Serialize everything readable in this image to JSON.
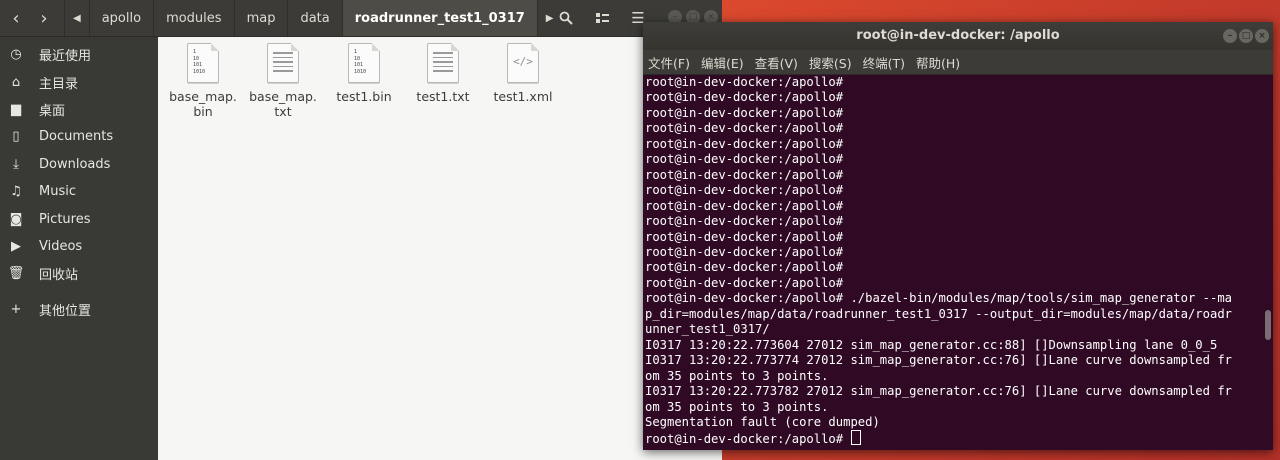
{
  "file_manager": {
    "breadcrumb": [
      "apollo",
      "modules",
      "map",
      "data",
      "roadrunner_test1_0317"
    ],
    "sidebar": [
      {
        "icon": "clock-icon",
        "glyph": "◷",
        "label": "最近使用"
      },
      {
        "icon": "home-icon",
        "glyph": "⌂",
        "label": "主目录"
      },
      {
        "icon": "folder-icon",
        "glyph": "▆",
        "label": "桌面"
      },
      {
        "icon": "document-icon",
        "glyph": "▯",
        "label": "Documents"
      },
      {
        "icon": "download-icon",
        "glyph": "⤓",
        "label": "Downloads"
      },
      {
        "icon": "music-icon",
        "glyph": "♫",
        "label": "Music"
      },
      {
        "icon": "camera-icon",
        "glyph": "◙",
        "label": "Pictures"
      },
      {
        "icon": "video-icon",
        "glyph": "▶",
        "label": "Videos"
      },
      {
        "icon": "trash-icon",
        "glyph": "🗑",
        "label": "回收站"
      },
      {
        "icon": "plus-icon",
        "glyph": "+",
        "label": "其他位置"
      }
    ],
    "files": [
      {
        "name": "base_map.bin",
        "line1": "base_map.",
        "line2": "bin",
        "type": "binary"
      },
      {
        "name": "base_map.txt",
        "line1": "base_map.",
        "line2": "txt",
        "type": "text"
      },
      {
        "name": "test1.bin",
        "line1": "test1.bin",
        "line2": "",
        "type": "binary"
      },
      {
        "name": "test1.txt",
        "line1": "test1.txt",
        "line2": "",
        "type": "text"
      },
      {
        "name": "test1.xml",
        "line1": "test1.xml",
        "line2": "",
        "type": "xml"
      }
    ],
    "binary_icon_text": "1\n10\n101\n1010",
    "xml_icon_text": "</>"
  },
  "terminal": {
    "title": "root@in-dev-docker: /apollo",
    "menu": [
      "文件(F)",
      "编辑(E)",
      "查看(V)",
      "搜索(S)",
      "终端(T)",
      "帮助(H)"
    ],
    "lines": [
      "root@in-dev-docker:/apollo#",
      "root@in-dev-docker:/apollo#",
      "root@in-dev-docker:/apollo#",
      "root@in-dev-docker:/apollo#",
      "root@in-dev-docker:/apollo#",
      "root@in-dev-docker:/apollo#",
      "root@in-dev-docker:/apollo#",
      "root@in-dev-docker:/apollo#",
      "root@in-dev-docker:/apollo#",
      "root@in-dev-docker:/apollo#",
      "root@in-dev-docker:/apollo#",
      "root@in-dev-docker:/apollo#",
      "root@in-dev-docker:/apollo#",
      "root@in-dev-docker:/apollo#",
      "root@in-dev-docker:/apollo# ./bazel-bin/modules/map/tools/sim_map_generator --ma",
      "p_dir=modules/map/data/roadrunner_test1_0317 --output_dir=modules/map/data/roadr",
      "unner_test1_0317/",
      "I0317 13:20:22.773604 27012 sim_map_generator.cc:88] []Downsampling lane 0_0_5",
      "I0317 13:20:22.773774 27012 sim_map_generator.cc:76] []Lane curve downsampled fr",
      "om 35 points to 3 points.",
      "I0317 13:20:22.773782 27012 sim_map_generator.cc:76] []Lane curve downsampled fr",
      "om 35 points to 3 points.",
      "Segmentation fault (core dumped)"
    ],
    "prompt": "root@in-dev-docker:/apollo# "
  },
  "colors": {
    "terminal_bg": "#300a24",
    "headerbar": "#3c3b37",
    "sidebar": "#393935",
    "desktop": "#dd4a2e"
  }
}
